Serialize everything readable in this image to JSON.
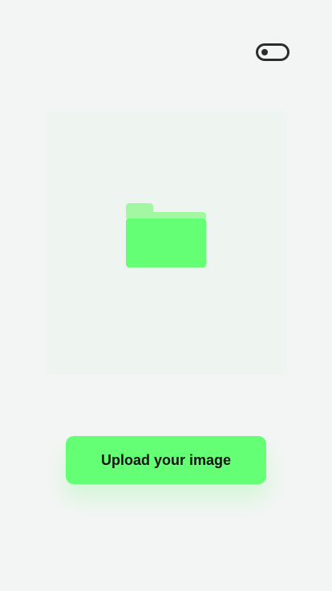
{
  "theme_toggle": {
    "icon": "toggle-icon",
    "state": "off",
    "color": "#2b2d2d"
  },
  "dropzone": {
    "icon": "folder-icon",
    "border_color": "#7ee77e",
    "background": "#eef4ef"
  },
  "upload": {
    "button_label": "Upload your image",
    "color": "#64ff74"
  }
}
